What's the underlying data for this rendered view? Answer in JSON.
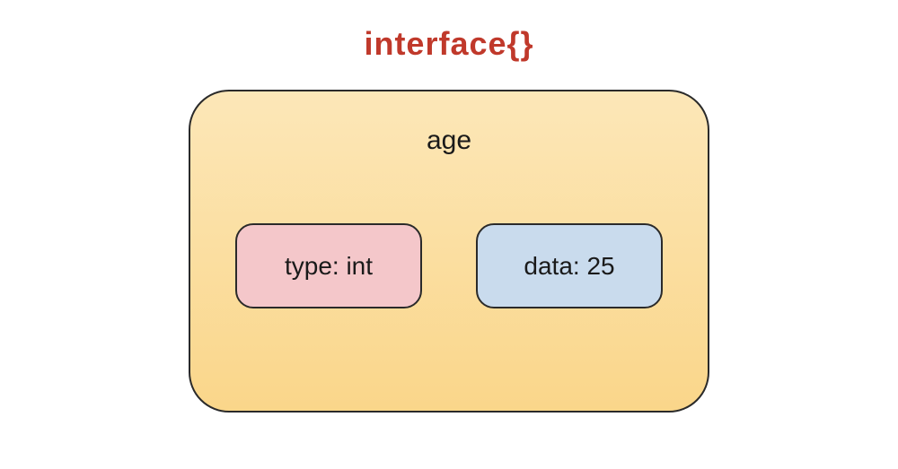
{
  "title": "interface{}",
  "container": {
    "variable_name": "age",
    "type_box": "type: int",
    "data_box": "data: 25"
  }
}
